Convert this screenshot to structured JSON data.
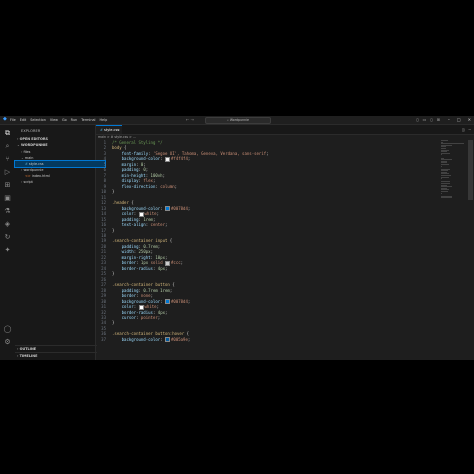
{
  "titlebar": {
    "menu": [
      "File",
      "Edit",
      "Selection",
      "View",
      "Go",
      "Run",
      "Terminal",
      "Help"
    ],
    "search": "Wordpunnie"
  },
  "activity_icons": [
    "files-icon",
    "search-icon",
    "source-control-icon",
    "run-debug-icon",
    "extensions-icon",
    "remote-icon",
    "testing-icon",
    "docker-icon",
    "live-share-icon",
    "accounts-icon",
    "settings-icon"
  ],
  "sidebar": {
    "title": "EXPLORER",
    "open_editors": "OPEN EDITORS",
    "project": "WORDPUNNIE",
    "tree": [
      {
        "label": "files",
        "indent": 1,
        "caret": ">"
      },
      {
        "label": "main",
        "indent": 1,
        "caret": "v"
      },
      {
        "label": "style.css",
        "indent": 2,
        "caret": "#",
        "selected": true
      },
      {
        "label": "wordpunnie",
        "indent": 1,
        "caret": ">"
      },
      {
        "label": "index.html",
        "indent": 2,
        "caret": "<>"
      },
      {
        "label": "script",
        "indent": 1,
        "caret": ">"
      }
    ],
    "outline": "OUTLINE",
    "timeline": "TIMELINE"
  },
  "editor": {
    "tab_label": "style.css",
    "breadcrumb": "main > # style.css > ..."
  },
  "code_lines": [
    {
      "n": "1",
      "parts": [
        [
          "c-comment",
          "/* General Styling */"
        ]
      ]
    },
    {
      "n": "2",
      "parts": [
        [
          "c-sel",
          "body"
        ],
        [
          "c-punc",
          " {"
        ]
      ]
    },
    {
      "n": "3",
      "parts": [
        [
          "c-prop",
          "    font-family"
        ],
        [
          "c-punc",
          ": "
        ],
        [
          "c-val",
          "'Segoe UI', Tahoma, Geneva, Verdana, sans-serif"
        ],
        [
          "c-punc",
          ";"
        ]
      ]
    },
    {
      "n": "4",
      "parts": [
        [
          "c-prop",
          "    background-color"
        ],
        [
          "c-punc",
          ": "
        ],
        [
          "swatch",
          "#f4f4f4"
        ],
        [
          "c-val",
          "#f4f4f4"
        ],
        [
          "c-punc",
          ";"
        ]
      ]
    },
    {
      "n": "5",
      "parts": [
        [
          "c-prop",
          "    margin"
        ],
        [
          "c-punc",
          ": "
        ],
        [
          "c-num",
          "0"
        ],
        [
          "c-punc",
          ";"
        ]
      ]
    },
    {
      "n": "6",
      "parts": [
        [
          "c-prop",
          "    padding"
        ],
        [
          "c-punc",
          ": "
        ],
        [
          "c-num",
          "0"
        ],
        [
          "c-punc",
          ";"
        ]
      ]
    },
    {
      "n": "7",
      "parts": [
        [
          "c-prop",
          "    min-height"
        ],
        [
          "c-punc",
          ": "
        ],
        [
          "c-num",
          "100vh"
        ],
        [
          "c-punc",
          ";"
        ]
      ]
    },
    {
      "n": "8",
      "parts": [
        [
          "c-prop",
          "    display"
        ],
        [
          "c-punc",
          ": "
        ],
        [
          "c-val",
          "flex"
        ],
        [
          "c-punc",
          ";"
        ]
      ]
    },
    {
      "n": "9",
      "parts": [
        [
          "c-prop",
          "    flex-direction"
        ],
        [
          "c-punc",
          ": "
        ],
        [
          "c-val",
          "column"
        ],
        [
          "c-punc",
          ";"
        ]
      ]
    },
    {
      "n": "10",
      "parts": [
        [
          "c-punc",
          "}"
        ]
      ]
    },
    {
      "n": "11",
      "parts": []
    },
    {
      "n": "12",
      "parts": [
        [
          "c-sel",
          ".header"
        ],
        [
          "c-punc",
          " {"
        ]
      ]
    },
    {
      "n": "13",
      "parts": [
        [
          "c-prop",
          "    background-color"
        ],
        [
          "c-punc",
          ": "
        ],
        [
          "swatch",
          "#0078d4"
        ],
        [
          "c-val",
          "#0078d4"
        ],
        [
          "c-punc",
          ";"
        ]
      ]
    },
    {
      "n": "14",
      "parts": [
        [
          "c-prop",
          "    color"
        ],
        [
          "c-punc",
          ": "
        ],
        [
          "swatch",
          "#ffffff"
        ],
        [
          "c-val",
          "white"
        ],
        [
          "c-punc",
          ";"
        ]
      ]
    },
    {
      "n": "15",
      "parts": [
        [
          "c-prop",
          "    padding"
        ],
        [
          "c-punc",
          ": "
        ],
        [
          "c-num",
          "1rem"
        ],
        [
          "c-punc",
          ";"
        ]
      ]
    },
    {
      "n": "16",
      "parts": [
        [
          "c-prop",
          "    text-align"
        ],
        [
          "c-punc",
          ": "
        ],
        [
          "c-val",
          "center"
        ],
        [
          "c-punc",
          ";"
        ]
      ]
    },
    {
      "n": "17",
      "parts": [
        [
          "c-punc",
          "}"
        ]
      ]
    },
    {
      "n": "18",
      "parts": []
    },
    {
      "n": "19",
      "parts": [
        [
          "c-sel",
          ".search-container input"
        ],
        [
          "c-punc",
          " {"
        ]
      ]
    },
    {
      "n": "20",
      "parts": [
        [
          "c-prop",
          "    padding"
        ],
        [
          "c-punc",
          ": "
        ],
        [
          "c-num",
          "0.7rem"
        ],
        [
          "c-punc",
          ";"
        ]
      ]
    },
    {
      "n": "21",
      "parts": [
        [
          "c-prop",
          "    width"
        ],
        [
          "c-punc",
          ": "
        ],
        [
          "c-num",
          "250px"
        ],
        [
          "c-punc",
          ";"
        ]
      ]
    },
    {
      "n": "22",
      "parts": [
        [
          "c-prop",
          "    margin-right"
        ],
        [
          "c-punc",
          ": "
        ],
        [
          "c-num",
          "10px"
        ],
        [
          "c-punc",
          ";"
        ]
      ]
    },
    {
      "n": "23",
      "parts": [
        [
          "c-prop",
          "    border"
        ],
        [
          "c-punc",
          ": "
        ],
        [
          "c-num",
          "1px"
        ],
        [
          "c-val",
          " solid "
        ],
        [
          "swatch",
          "#cccccc"
        ],
        [
          "c-val",
          "#ccc"
        ],
        [
          "c-punc",
          ";"
        ]
      ]
    },
    {
      "n": "24",
      "parts": [
        [
          "c-prop",
          "    border-radius"
        ],
        [
          "c-punc",
          ": "
        ],
        [
          "c-num",
          "4px"
        ],
        [
          "c-punc",
          ";"
        ]
      ]
    },
    {
      "n": "25",
      "parts": [
        [
          "c-punc",
          "}"
        ]
      ]
    },
    {
      "n": "26",
      "parts": []
    },
    {
      "n": "27",
      "parts": [
        [
          "c-sel",
          ".search-container button"
        ],
        [
          "c-punc",
          " {"
        ]
      ]
    },
    {
      "n": "28",
      "parts": [
        [
          "c-prop",
          "    padding"
        ],
        [
          "c-punc",
          ": "
        ],
        [
          "c-num",
          "0.7rem 1rem"
        ],
        [
          "c-punc",
          ";"
        ]
      ]
    },
    {
      "n": "29",
      "parts": [
        [
          "c-prop",
          "    border"
        ],
        [
          "c-punc",
          ": "
        ],
        [
          "c-val",
          "none"
        ],
        [
          "c-punc",
          ";"
        ]
      ]
    },
    {
      "n": "30",
      "parts": [
        [
          "c-prop",
          "    background-color"
        ],
        [
          "c-punc",
          ": "
        ],
        [
          "swatch",
          "#0078d4"
        ],
        [
          "c-val",
          "#0078d4"
        ],
        [
          "c-punc",
          ";"
        ]
      ]
    },
    {
      "n": "31",
      "parts": [
        [
          "c-prop",
          "    color"
        ],
        [
          "c-punc",
          ": "
        ],
        [
          "swatch",
          "#ffffff"
        ],
        [
          "c-val",
          "white"
        ],
        [
          "c-punc",
          ";"
        ]
      ]
    },
    {
      "n": "32",
      "parts": [
        [
          "c-prop",
          "    border-radius"
        ],
        [
          "c-punc",
          ": "
        ],
        [
          "c-num",
          "4px"
        ],
        [
          "c-punc",
          ";"
        ]
      ]
    },
    {
      "n": "33",
      "parts": [
        [
          "c-prop",
          "    cursor"
        ],
        [
          "c-punc",
          ": "
        ],
        [
          "c-val",
          "pointer"
        ],
        [
          "c-punc",
          ";"
        ]
      ]
    },
    {
      "n": "34",
      "parts": [
        [
          "c-punc",
          "}"
        ]
      ]
    },
    {
      "n": "35",
      "parts": []
    },
    {
      "n": "36",
      "parts": [
        [
          "c-sel",
          ".search-container button:hover"
        ],
        [
          "c-punc",
          " {"
        ]
      ]
    },
    {
      "n": "37",
      "parts": [
        [
          "c-prop",
          "    background-color"
        ],
        [
          "c-punc",
          ": "
        ],
        [
          "swatch",
          "#005a9e"
        ],
        [
          "c-val",
          "#005a9e"
        ],
        [
          "c-punc",
          ";"
        ]
      ]
    }
  ],
  "colors": {
    "accent": "#0078d4",
    "editor_bg": "#1e1e1e",
    "sidebar_bg": "#181818"
  }
}
